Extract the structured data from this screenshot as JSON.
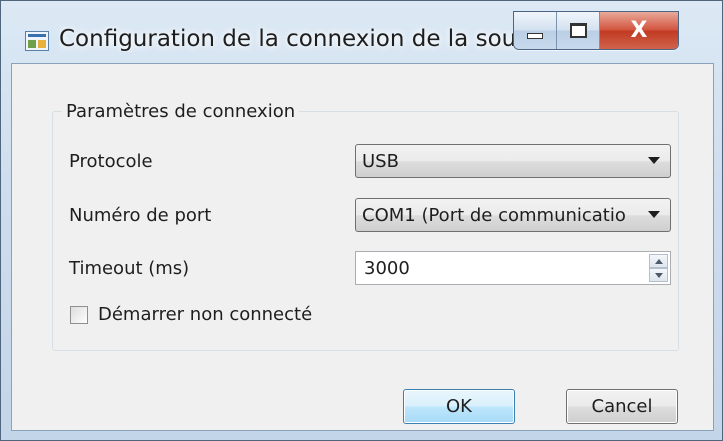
{
  "window": {
    "title": "Configuration de la connexion de la sou...",
    "icon": "app-window-icon",
    "controls": {
      "minimize": "minimize-icon",
      "maximize": "maximize-icon",
      "close_label": "X"
    }
  },
  "group": {
    "title": "Paramètres de connexion",
    "protocol": {
      "label": "Protocole",
      "value": "USB"
    },
    "port": {
      "label": "Numéro de port",
      "value": "COM1 (Port de communicatio"
    },
    "timeout": {
      "label": "Timeout (ms)",
      "value": "3000"
    },
    "start_offline": {
      "label": "Démarrer non connecté",
      "checked": false
    }
  },
  "buttons": {
    "ok": "OK",
    "cancel": "Cancel"
  },
  "colors": {
    "accent": "#3c7fb1",
    "close": "#c23a22"
  }
}
